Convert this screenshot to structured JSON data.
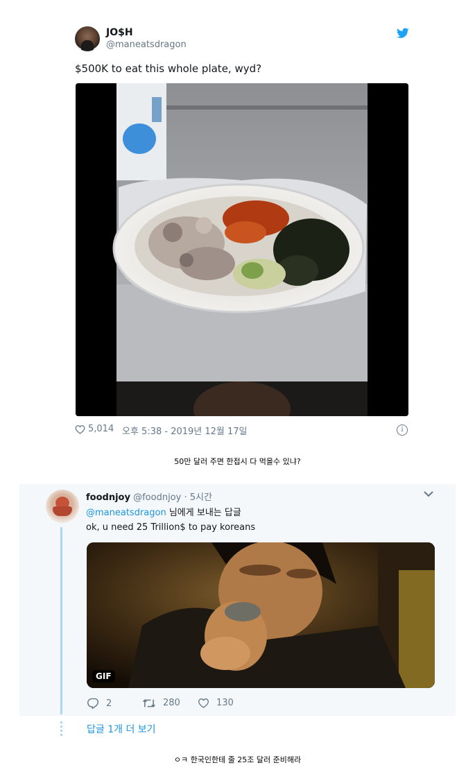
{
  "tweet": {
    "name": "JO$H",
    "handle": "@maneatsdragon",
    "text": "$500K to eat this whole plate, wyd?",
    "likes": "5,014",
    "timestamp": "오후 5:38 - 2019년 12월 17일",
    "icons": [
      "twitter-bird-icon",
      "heart-icon",
      "info-icon"
    ]
  },
  "caption_top": "50만 달러 주면 한접시 다 먹을수 있냐?",
  "reply": {
    "name": "foodnjoy",
    "handle": "@foodnjoy",
    "time": "· 5시간",
    "replying_mention": "@maneatsdragon",
    "replying_suffix": " 님에게 보내는 답글",
    "text": "ok, u need 25 Trillion$ to pay koreans",
    "gif_label": "GIF",
    "replies": "2",
    "retweets": "280",
    "likes": "130",
    "more_replies": "답글 1개 더 보기",
    "icons": [
      "chevron-down-icon",
      "reply-icon",
      "retweet-icon",
      "heart-icon"
    ]
  },
  "caption_bottom": "ㅇㅋ 한국인한테 줄 25조 달러 준비해라",
  "colors": {
    "link": "#1b95e0",
    "muted": "#657786",
    "thread": "#aad8f2",
    "card_bg": "#f5f8fa"
  }
}
